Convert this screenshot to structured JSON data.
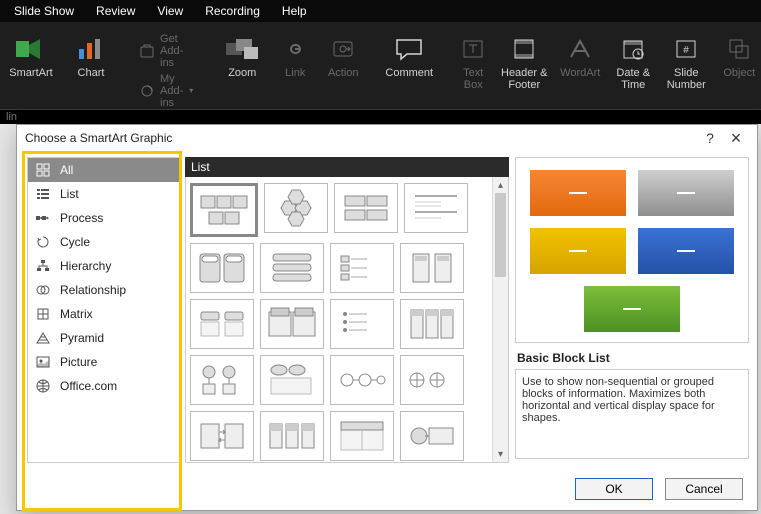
{
  "menubar": [
    "Slide Show",
    "Review",
    "View",
    "Recording",
    "Help"
  ],
  "ribbon": {
    "smartart": "SmartArt",
    "chart": "Chart",
    "get_addins": "Get Add-ins",
    "my_addins": "My Add-ins",
    "zoom": "Zoom",
    "link": "Link",
    "action": "Action",
    "comment": "Comment",
    "text_box": "Text Box",
    "header_footer": "Header & Footer",
    "wordart": "WordArt",
    "date_time": "Date & Time",
    "slide_number": "Slide Number",
    "object": "Object"
  },
  "secondary": {
    "label": "lin"
  },
  "dialog": {
    "title": "Choose a SmartArt Graphic",
    "help": "?",
    "close": "×",
    "gallery_header": "List",
    "categories": [
      {
        "label": "All",
        "selected": true
      },
      {
        "label": "List"
      },
      {
        "label": "Process"
      },
      {
        "label": "Cycle"
      },
      {
        "label": "Hierarchy"
      },
      {
        "label": "Relationship"
      },
      {
        "label": "Matrix"
      },
      {
        "label": "Pyramid"
      },
      {
        "label": "Picture"
      },
      {
        "label": "Office.com"
      }
    ],
    "preview_title": "Basic Block List",
    "preview_desc": "Use to show non-sequential or grouped blocks of information. Maximizes both horizontal and vertical display space for shapes.",
    "ok": "OK",
    "cancel": "Cancel",
    "colors": {
      "block1": "#ed7d31",
      "block2": "#a5a5a5",
      "block3": "#ffc000",
      "block4": "#2f5597",
      "block5": "#70ad47"
    }
  }
}
